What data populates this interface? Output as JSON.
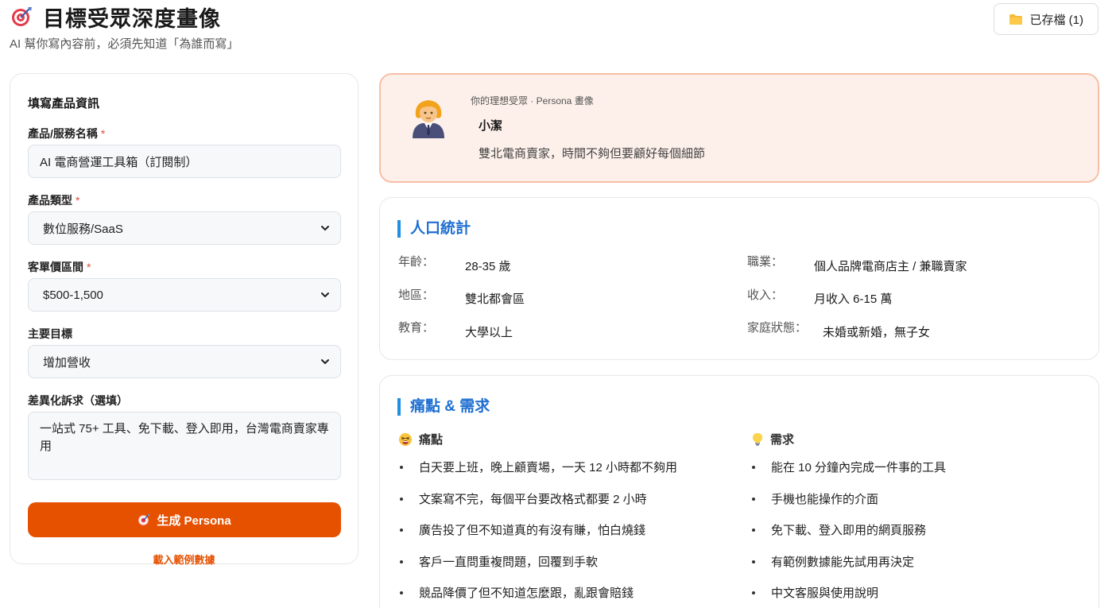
{
  "header": {
    "title": "目標受眾深度畫像",
    "subtitle": "AI 幫你寫內容前，必須先知道「為誰而寫」",
    "saved_label": "已存檔 (1)"
  },
  "form": {
    "heading": "填寫產品資訊",
    "product_name_label": "產品/服務名稱",
    "product_name_value": "AI 電商營運工具箱（訂閱制）",
    "product_type_label": "產品類型",
    "product_type_value": "數位服務/SaaS",
    "price_label": "客單價區間",
    "price_value": "$500-1,500",
    "goal_label": "主要目標",
    "goal_value": "增加營收",
    "diff_label": "差異化訴求（選填）",
    "diff_value": "一站式 75+ 工具、免下載、登入即用，台灣電商賣家專用",
    "required_mark": "*",
    "generate_label": "生成 Persona",
    "sample_label": "載入範例數據"
  },
  "persona": {
    "kicker": "你的理想受眾 · Persona 畫像",
    "name": "小潔",
    "description": "雙北電商賣家，時間不夠但要顧好每個細節"
  },
  "demographics": {
    "title": "人口統計",
    "age_label": "年齡：",
    "age_value": "28-35 歲",
    "job_label": "職業：",
    "job_value": "個人品牌電商店主 / 兼職賣家",
    "region_label": "地區：",
    "region_value": "雙北都會區",
    "income_label": "收入：",
    "income_value": "月收入 6-15 萬",
    "edu_label": "教育：",
    "edu_value": "大學以上",
    "family_label": "家庭狀態：",
    "family_value": "未婚或新婚，無子女"
  },
  "pain_needs": {
    "title": "痛點 & 需求",
    "pain_head": "痛點",
    "needs_head": "需求",
    "pains": [
      "白天要上班，晚上顧賣場，一天 12 小時都不夠用",
      "文案寫不完，每個平台要改格式都要 2 小時",
      "廣告投了但不知道真的有沒有賺，怕白燒錢",
      "客戶一直問重複問題，回覆到手軟",
      "競品降價了但不知道怎麼跟，亂跟會賠錢"
    ],
    "needs": [
      "能在 10 分鐘內完成一件事的工具",
      "手機也能操作的介面",
      "免下載、登入即用的網頁服務",
      "有範例數據能先試用再決定",
      "中文客服與使用說明"
    ]
  },
  "colors": {
    "accent": "#e65100",
    "section_blue": "#1f6fd1",
    "persona_bg": "#fdf0ea",
    "persona_border": "#f6c0a6"
  },
  "icons": {
    "title": "target-icon",
    "saved": "folder-icon",
    "avatar": "woman-office-worker-icon",
    "pain": "tired-face-icon",
    "needs": "lightbulb-icon",
    "select": "chevron-down-icon"
  }
}
